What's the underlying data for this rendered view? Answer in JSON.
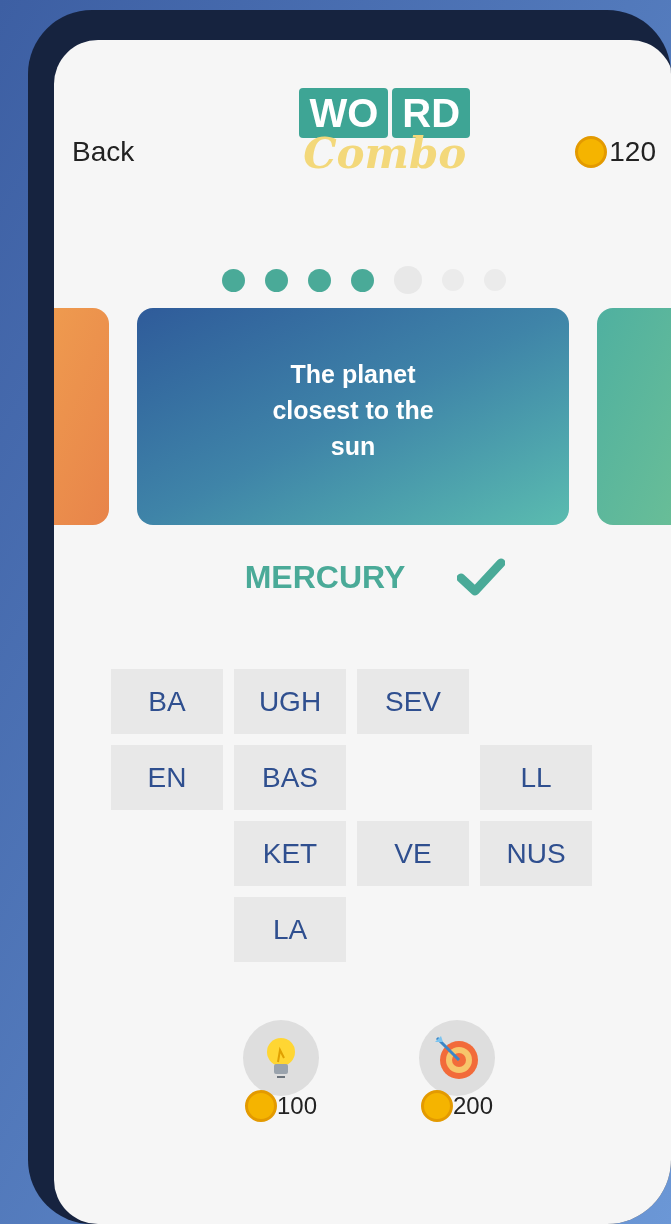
{
  "header": {
    "back": "Back",
    "logo": {
      "word_parts": [
        "WO",
        "RD"
      ],
      "subtitle": "Combo"
    },
    "coins": "120"
  },
  "progress": [
    {
      "kind": "done"
    },
    {
      "kind": "done"
    },
    {
      "kind": "done"
    },
    {
      "kind": "done"
    },
    {
      "kind": "current"
    },
    {
      "kind": "upcoming"
    },
    {
      "kind": "upcoming"
    }
  ],
  "card": {
    "clue": "The planet closest to the sun"
  },
  "answer": {
    "word": "MERCURY",
    "correct": true
  },
  "tiles": [
    {
      "kind": "tile",
      "text": "BA"
    },
    {
      "kind": "tile",
      "text": "UGH"
    },
    {
      "kind": "tile",
      "text": "SEV"
    },
    {
      "kind": "gap"
    },
    {
      "kind": "tile",
      "text": "EN"
    },
    {
      "kind": "tile",
      "text": "BAS"
    },
    {
      "kind": "gap"
    },
    {
      "kind": "tile",
      "text": "LL"
    },
    {
      "kind": "gap"
    },
    {
      "kind": "tile",
      "text": "KET"
    },
    {
      "kind": "tile",
      "text": "VE"
    },
    {
      "kind": "tile",
      "text": "NUS"
    },
    {
      "kind": "gap"
    },
    {
      "kind": "tile",
      "text": "LA"
    },
    {
      "kind": "gap"
    },
    {
      "kind": "gap"
    }
  ],
  "hints": [
    {
      "kind": "bulb",
      "cost": "100"
    },
    {
      "kind": "target",
      "cost": "200"
    }
  ]
}
